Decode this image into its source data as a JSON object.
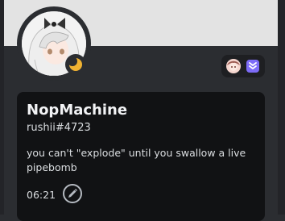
{
  "profile": {
    "display_name": "NopMachine",
    "username": "rushii#4723",
    "bio": "you can't \"explode\" until you swallow a live pipebomb",
    "local_time": "06:21",
    "status": "idle",
    "banner_color": "#e3e3e3",
    "status_color": "#f0b232",
    "badges": [
      "avatar-badge",
      "nitro-chevron-badge"
    ]
  }
}
